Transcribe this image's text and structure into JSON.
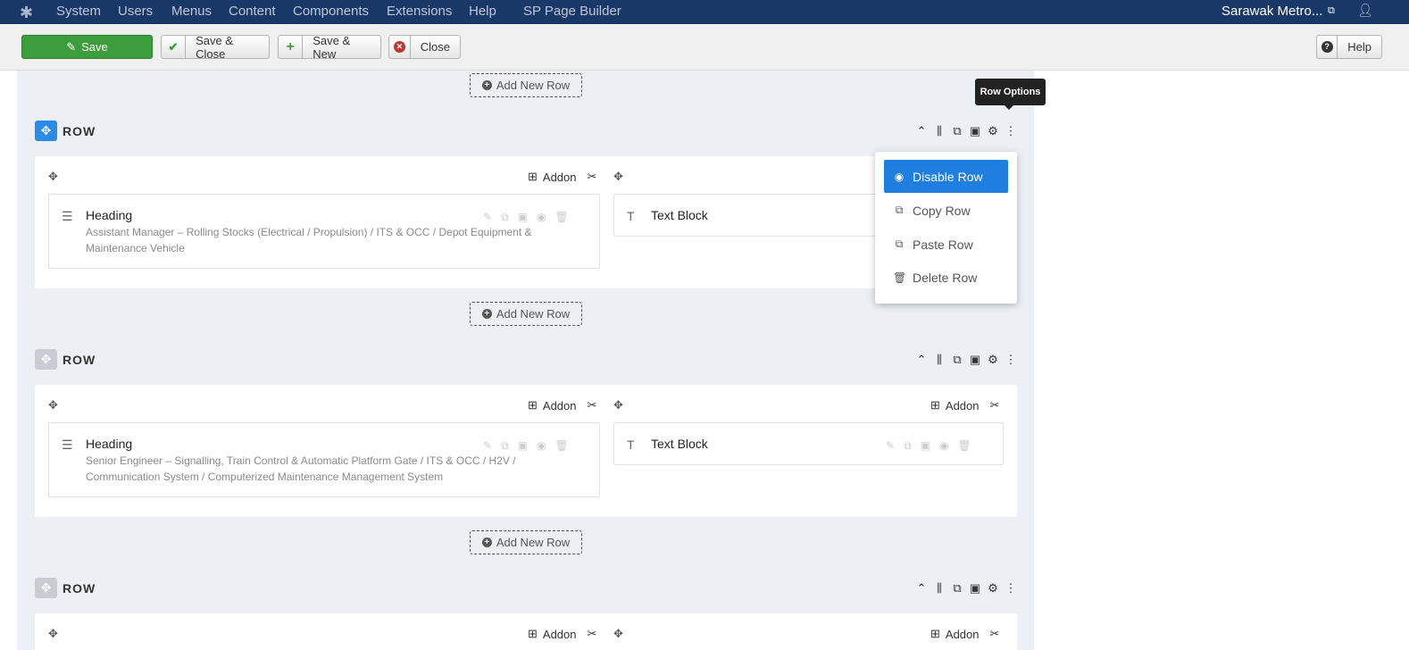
{
  "nav": {
    "menu": [
      "System",
      "Users",
      "Menus",
      "Content",
      "Components",
      "Extensions",
      "Help",
      "SP Page Builder"
    ],
    "site": "Sarawak Metro..."
  },
  "toolbar": {
    "save": "Save",
    "save_close": "Save & Close",
    "save_new": "Save & New",
    "close": "Close",
    "help": "Help"
  },
  "builder": {
    "add_row": "Add New Row",
    "row_label": "ROW",
    "addon_label": "Addon",
    "tooltip": "Row Options",
    "row_menu": [
      "Disable Row",
      "Copy Row",
      "Paste Row",
      "Delete Row"
    ],
    "rows": [
      {
        "heading": "Heading",
        "heading_desc": "Assistant Manager – Rolling Stocks (Electrical / Propulsion) / ITS & OCC / Depot Equipment & Maintenance Vehicle",
        "text": "Text Block"
      },
      {
        "heading": "Heading",
        "heading_desc": "Senior Engineer – Signalling, Train Control & Automatic Platform Gate / ITS & OCC / H2V / Communication System / Computerized Maintenance Management System",
        "text": "Text Block"
      }
    ]
  },
  "colors": {
    "nav": "#1a3867",
    "save": "#3b9d3b",
    "accent": "#1f7fe0",
    "canvas": "#eceff4"
  },
  "icons": [
    "joomla-logo-icon",
    "external-link-icon",
    "user-icon",
    "edit-icon",
    "check-icon",
    "plus-icon",
    "close-circle-icon",
    "help-icon",
    "plus-circle-icon",
    "move-icon",
    "collapse-icon",
    "columns-icon",
    "copy-icon",
    "save-icon",
    "gear-icon",
    "kebab-icon",
    "add-addon-icon",
    "tools-icon",
    "heading-icon",
    "text-block-icon",
    "eye-icon",
    "trash-icon",
    "paste-icon"
  ]
}
